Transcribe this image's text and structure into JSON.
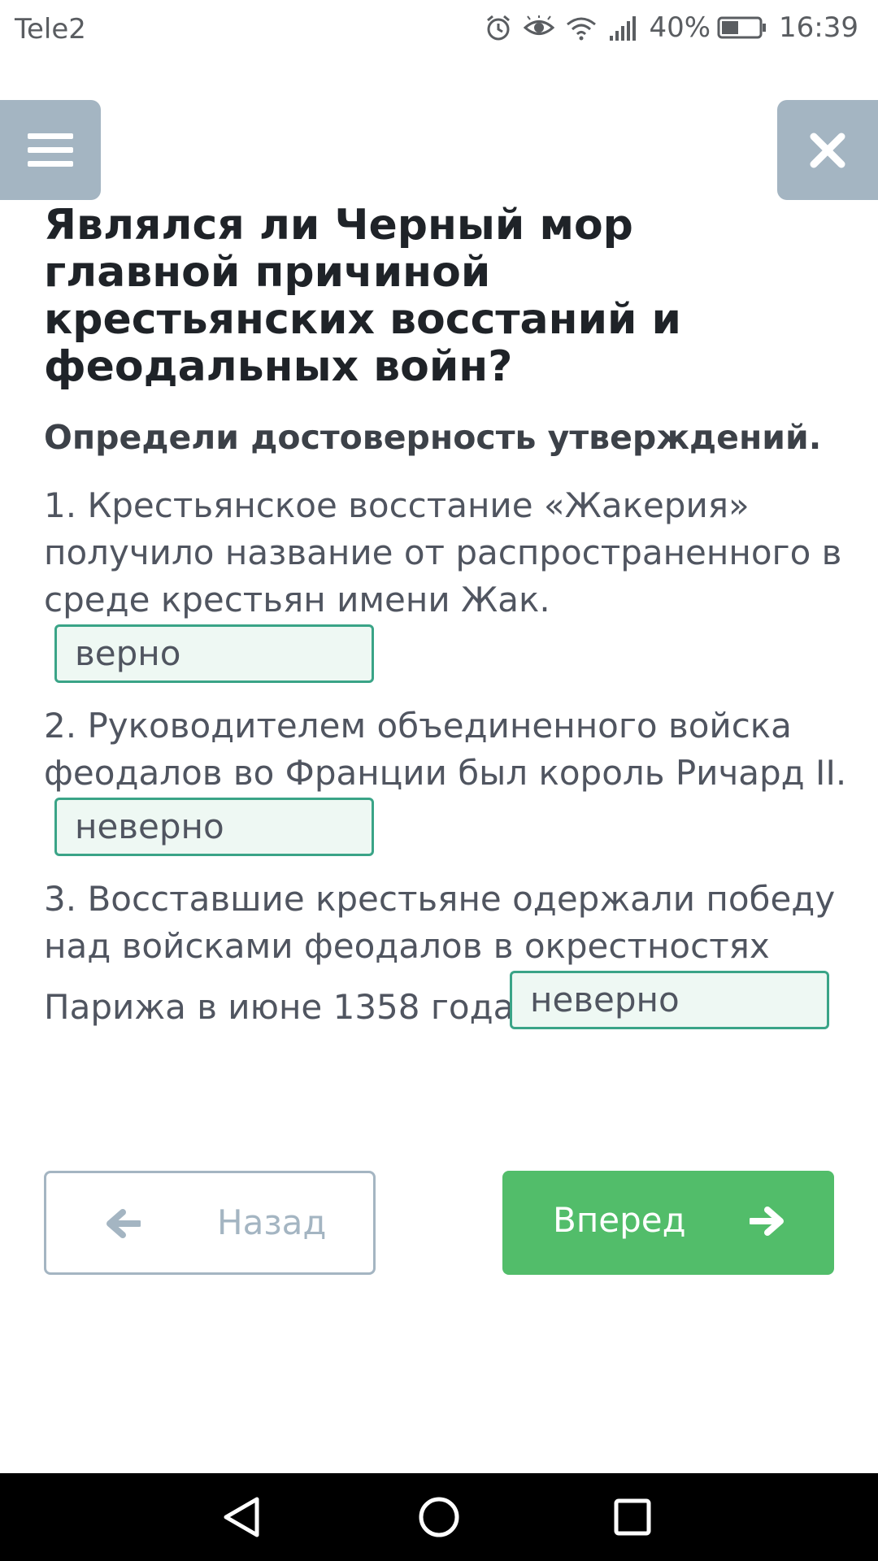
{
  "status_bar": {
    "carrier": "Tele2",
    "battery_percent": "40%",
    "time": "16:39",
    "icons": [
      "alarm-icon",
      "eye-icon",
      "wifi-icon",
      "signal-icon",
      "battery-icon"
    ]
  },
  "header": {
    "menu_icon": "hamburger-menu-icon",
    "close_icon": "close-icon"
  },
  "question": {
    "title": "Являлся ли Черный мор главной причиной крестьянских восстаний и феодальных войн?",
    "instruction": "Определи достоверность утверждений."
  },
  "statements": [
    {
      "number": "1.",
      "text": "Крестьянское восстание «Жакерия» получило название от распространенного в среде крестьян имени Жак.",
      "answer": "верно"
    },
    {
      "number": "2.",
      "text": "Руководителем объединенного войска феодалов во Франции был король Ричард II.",
      "answer": "неверно"
    },
    {
      "number": "3.",
      "text_line1": "Восставшие крестьяне одержали победу над войсками феодалов в окрестностях",
      "text_line2": "Парижа в июне 1358 года.",
      "answer": "неверно"
    }
  ],
  "navigation": {
    "back_label": "Назад",
    "next_label": "Вперед"
  },
  "colors": {
    "accent_green": "#52bd6a",
    "answer_border": "#3aa487",
    "answer_bg": "#eef8f3",
    "grey_button": "#a4b5c2"
  }
}
